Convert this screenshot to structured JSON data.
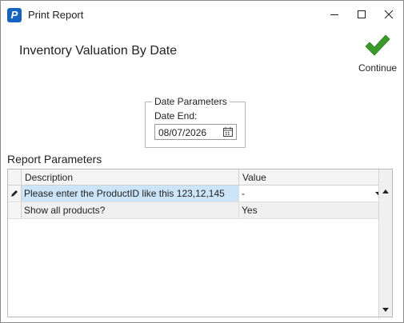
{
  "window": {
    "title": "Print Report",
    "app_icon_letter": "P",
    "controls": [
      "minimize-icon",
      "maximize-icon",
      "close-icon"
    ]
  },
  "report": {
    "title": "Inventory Valuation By Date",
    "continue_label": "Continue",
    "continue_icon": "checkmark-icon",
    "accent_color": "#3a9a2a"
  },
  "date_parameters": {
    "legend": "Date Parameters",
    "date_end_label": "Date End:",
    "date_end_value": "08/07/2026",
    "picker_icon": "calendar-icon"
  },
  "report_parameters": {
    "label": "Report Parameters",
    "columns": [
      "Description",
      "Value"
    ],
    "rows": [
      {
        "description": "Please enter the ProductID like this 123,12,145",
        "value": "-",
        "editing": true
      },
      {
        "description": "Show all products?",
        "value": "Yes",
        "editing": false
      }
    ],
    "selection_color": "#cce4f7"
  }
}
